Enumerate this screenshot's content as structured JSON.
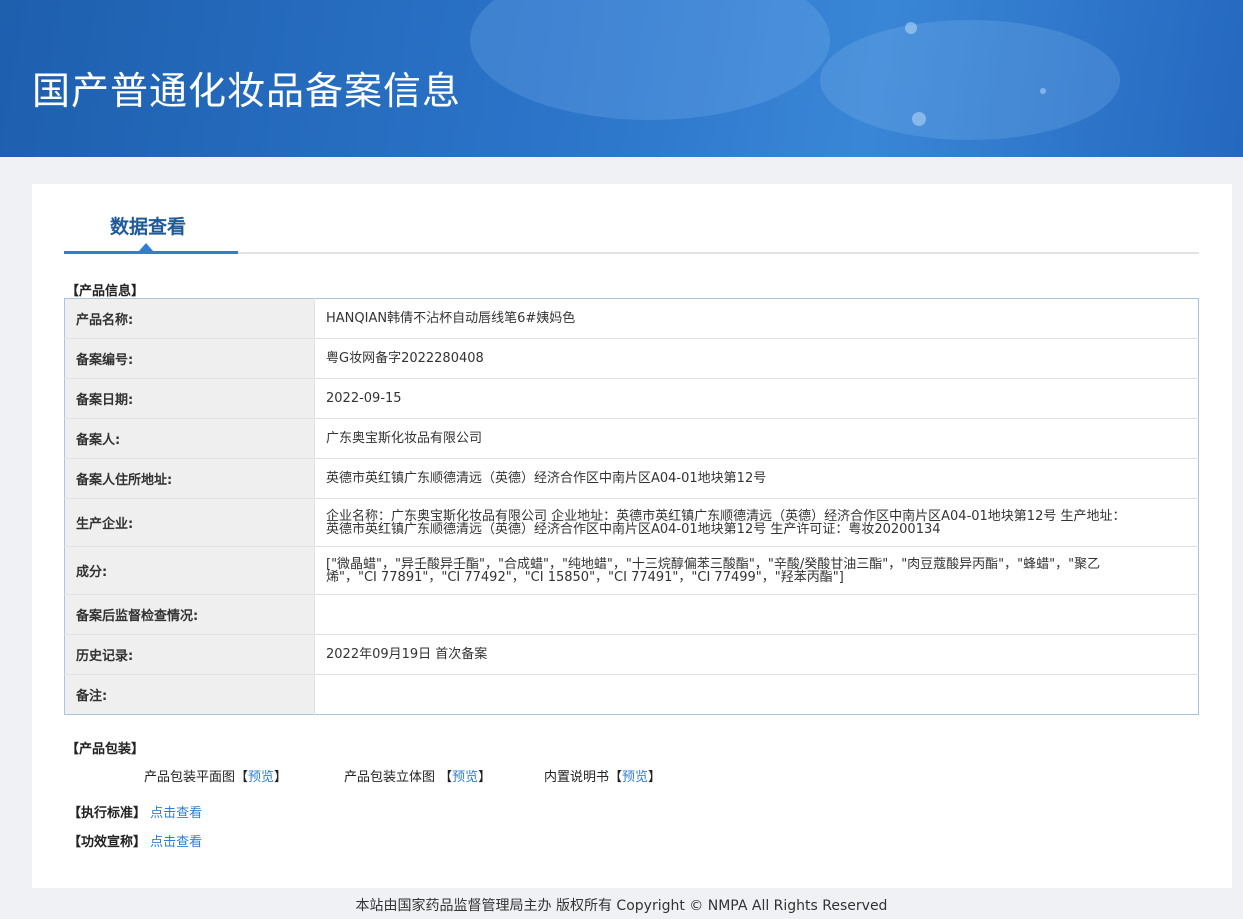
{
  "header": {
    "title": "国产普通化妆品备案信息"
  },
  "tab": {
    "label": "数据查看"
  },
  "sections": {
    "product_info": "【产品信息】",
    "packaging": "【产品包装】",
    "standard": "【执行标准】",
    "efficacy": "【功效宣称】"
  },
  "product_info": {
    "rows": [
      {
        "label": "产品名称:",
        "value": "HANQIAN韩倩不沾杯自动唇线笔6#姨妈色"
      },
      {
        "label": "备案编号:",
        "value": "粤G妆网备字2022280408"
      },
      {
        "label": "备案日期:",
        "value": "2022-09-15"
      },
      {
        "label": "备案人:",
        "value": "广东奥宝斯化妆品有限公司"
      },
      {
        "label": "备案人住所地址:",
        "value": "英德市英红镇广东顺德清远（英德）经济合作区中南片区A04-01地块第12号"
      },
      {
        "label": "生产企业:",
        "value": "企业名称：广东奥宝斯化妆品有限公司 企业地址：英德市英红镇广东顺德清远（英德）经济合作区中南片区A04-01地块第12号 生产地址：英德市英红镇广东顺德清远（英德）经济合作区中南片区A04-01地块第12号 生产许可证：粤妆20200134"
      },
      {
        "label": "成分:",
        "value": "[\"微晶蜡\"，\"异壬酸异壬酯\"，\"合成蜡\"，\"纯地蜡\"，\"十三烷醇偏苯三酸酯\"，\"辛酸/癸酸甘油三酯\"，\"肉豆蔻酸异丙酯\"，\"蜂蜡\"，\"聚乙烯\"，\"CI 77891\"，\"CI 77492\"，\"CI 15850\"，\"CI 77491\"，\"CI 77499\"，\"羟苯丙酯\"]"
      },
      {
        "label": "备案后监督检查情况:",
        "value": ""
      },
      {
        "label": "历史记录:",
        "value": "2022年09月19日 首次备案"
      },
      {
        "label": "备注:",
        "value": ""
      }
    ]
  },
  "packaging": {
    "items": [
      {
        "label": "产品包装平面图",
        "link": "预览"
      },
      {
        "label": "产品包装立体图 ",
        "link": "预览"
      },
      {
        "label": "内置说明书",
        "link": "预览"
      }
    ]
  },
  "standard": {
    "link": "点击查看"
  },
  "efficacy": {
    "link": "点击查看"
  },
  "footer": {
    "text": "本站由国家药品监督管理局主办 版权所有 Copyright © NMPA All Rights Reserved"
  }
}
